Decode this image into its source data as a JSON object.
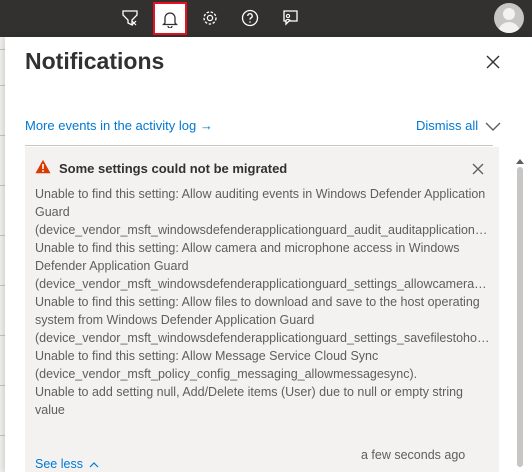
{
  "topbar": {
    "icons": [
      "feedback-filter-icon",
      "bell-icon",
      "gear-icon",
      "help-icon",
      "feedback-icon"
    ],
    "selected_icon": "bell-icon",
    "avatar": "user-avatar"
  },
  "panel": {
    "title": "Notifications",
    "activity_link": "More events in the activity log →",
    "dismiss_all": "Dismiss all"
  },
  "notification": {
    "icon": "warning-icon",
    "title": "Some settings could not be migrated",
    "lines": [
      "Unable to find this setting: Allow auditing events in Windows Defender Application Guard",
      "(device_vendor_msft_windowsdefenderapplicationguard_audit_auditapplicationguard)",
      "Unable to find this setting: Allow camera and microphone access in Windows Defender Application Guard",
      "(device_vendor_msft_windowsdefenderapplicationguard_settings_allowcameramicrophoneredirection)",
      "Unable to find this setting: Allow files to download and save to the host operating system from Windows Defender Application Guard",
      "(device_vendor_msft_windowsdefenderapplicationguard_settings_savefilestohost)",
      "Unable to find this setting: Allow Message Service Cloud Sync",
      "(device_vendor_msft_policy_config_messaging_allowmessagesync).",
      "Unable to add setting null, Add/Delete items (User) due to null or empty string value"
    ],
    "see_less": "See less",
    "timestamp": "a few seconds ago"
  },
  "colors": {
    "topbar": "#323130",
    "accent": "#0078d4",
    "warning": "#d83b01",
    "highlight_box": "#e81123"
  }
}
